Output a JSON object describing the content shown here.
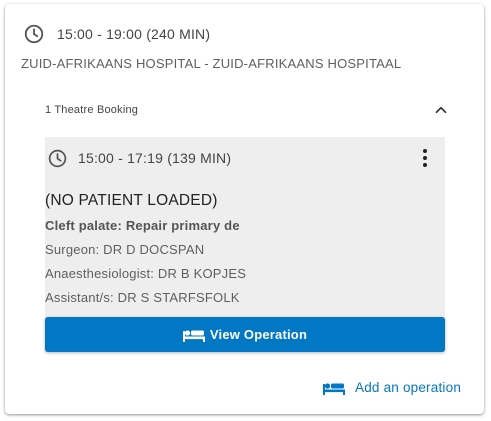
{
  "slot": {
    "time_range": "15:00 - 19:00 (240 MIN)",
    "hospital": "ZUID-AFRIKAANS HOSPITAL - ZUID-AFRIKAANS HOSPITAAL",
    "clock_icon": "clock-icon"
  },
  "bookings": {
    "count_label": "1 Theatre Booking",
    "collapse_icon": "chevron-up-icon",
    "operation": {
      "time_range": "15:00 - 17:19 (139 MIN)",
      "clock_icon": "clock-icon",
      "menu_icon": "more-vert-icon",
      "patient": "(NO PATIENT LOADED)",
      "procedure": "Cleft palate: Repair primary de",
      "surgeon": "Surgeon: DR D DOCSPAN",
      "anaesthesiologist": "Anaesthesiologist: DR B KOPJES",
      "assistants": "Assistant/s: DR S STARFSFOLK",
      "view_button_label": "View Operation",
      "view_button_icon": "hospital-bed-icon"
    }
  },
  "actions": {
    "add_operation_label": "Add an operation",
    "add_operation_icon": "hospital-bed-icon"
  },
  "colors": {
    "accent": "#0277c4",
    "panel_bg": "#eeeeee",
    "text_primary": "#222222",
    "text_secondary": "#5f5f5f"
  }
}
